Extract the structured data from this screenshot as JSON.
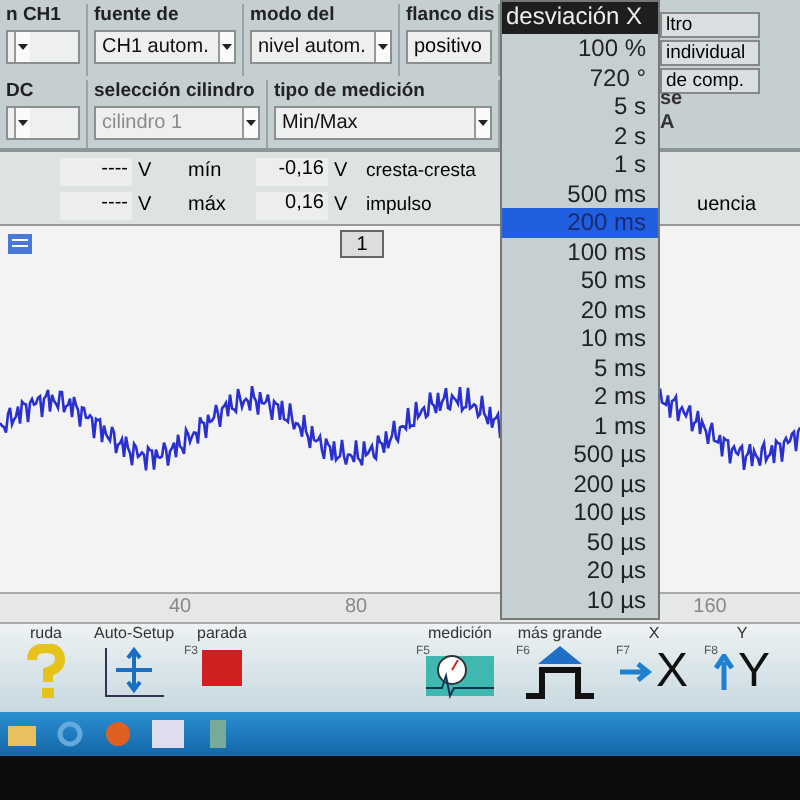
{
  "settings": {
    "rows": [
      [
        {
          "label": "n CH1",
          "kind": "select"
        },
        {
          "label": "fuente de",
          "value": "CH1 autom.",
          "kind": "select",
          "disabled": false
        },
        {
          "label": "modo del",
          "value": "nivel autom.",
          "kind": "select",
          "disabled": false
        },
        {
          "label": "flanco dis",
          "value": "positivo",
          "kind": "text"
        }
      ],
      [
        {
          "label": "DC",
          "kind": "select"
        },
        {
          "label": "selección cilindro",
          "value": "cilindro 1",
          "kind": "select",
          "disabled": true
        },
        {
          "label": "tipo de medición",
          "value": "Min/Max",
          "kind": "select",
          "disabled": false
        }
      ]
    ],
    "right_buttons": [
      "ltro",
      "individual",
      "de comp."
    ],
    "right_labels": [
      "se",
      "A"
    ]
  },
  "measurements": [
    {
      "value": "----",
      "unit": "V",
      "label": "mín",
      "value2": "-0,16",
      "unit2": "V",
      "label2": "cresta-cresta"
    },
    {
      "value": "----",
      "unit": "V",
      "label": "máx",
      "value2": "0,16",
      "unit2": "V",
      "label2": "impulso"
    }
  ],
  "measure_right": "uencia",
  "chart": {
    "channel": "1",
    "x_labels": [
      "40",
      "80",
      "160"
    ]
  },
  "dropdown": {
    "title": "desviación X",
    "items": [
      {
        "text": "100 %",
        "selected": false
      },
      {
        "text": "720 °",
        "selected": false
      },
      {
        "text": "5 s",
        "selected": false
      },
      {
        "text": "2 s",
        "selected": false
      },
      {
        "text": "1 s",
        "selected": false
      },
      {
        "text": "500 ms",
        "selected": false
      },
      {
        "text": "200 ms",
        "selected": true
      },
      {
        "text": "100 ms",
        "selected": false
      },
      {
        "text": "50 ms",
        "selected": false
      },
      {
        "text": "20 ms",
        "selected": false
      },
      {
        "text": "10 ms",
        "selected": false
      },
      {
        "text": "5 ms",
        "selected": false
      },
      {
        "text": "2 ms",
        "selected": false
      },
      {
        "text": "1 ms",
        "selected": false
      },
      {
        "text": "500 µs",
        "selected": false
      },
      {
        "text": "200 µs",
        "selected": false
      },
      {
        "text": "100 µs",
        "selected": false
      },
      {
        "text": "50 µs",
        "selected": false
      },
      {
        "text": "20 µs",
        "selected": false
      },
      {
        "text": "10 µs",
        "selected": false
      }
    ]
  },
  "toolbar": [
    {
      "label": "ruda",
      "kind": "help"
    },
    {
      "label": "Auto-Setup",
      "kind": "autosetup"
    },
    {
      "label": "parada",
      "fkey": "F3",
      "kind": "stop"
    },
    {
      "label": "medición",
      "fkey": "F5",
      "kind": "measure"
    },
    {
      "label": "más grande",
      "fkey": "F6",
      "kind": "bigger"
    },
    {
      "label": "X",
      "fkey": "F7",
      "kind": "x",
      "glyph": "X"
    },
    {
      "label": "Y",
      "fkey": "F8",
      "kind": "y",
      "glyph": "Y"
    }
  ]
}
